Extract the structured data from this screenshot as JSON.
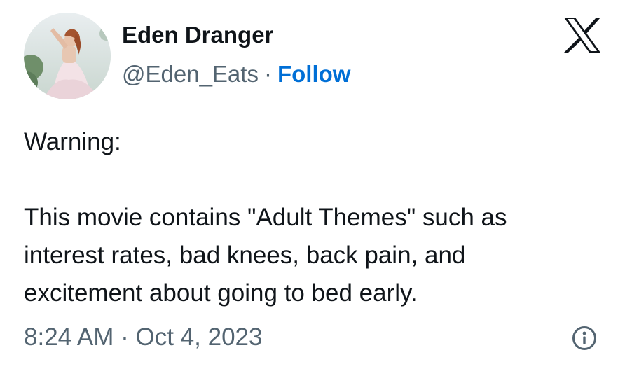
{
  "author": {
    "name": "Eden Dranger",
    "handle": "@Eden_Eats",
    "separator": "·",
    "follow_label": "Follow",
    "avatar_icon": "profile-photo-avatar"
  },
  "platform": {
    "logo_icon": "x-logo-icon"
  },
  "tweet": {
    "lines": [
      "Warning:",
      "",
      "This movie contains \"Adult Themes\" such as",
      "interest rates, bad knees, back pain, and",
      "excitement about going to bed early."
    ],
    "timestamp": "8:24 AM · Oct 4, 2023"
  },
  "colors": {
    "text": "#0f1419",
    "secondary": "#536471",
    "link": "#006fd6"
  },
  "icons": {
    "info": "info-circle-icon"
  }
}
